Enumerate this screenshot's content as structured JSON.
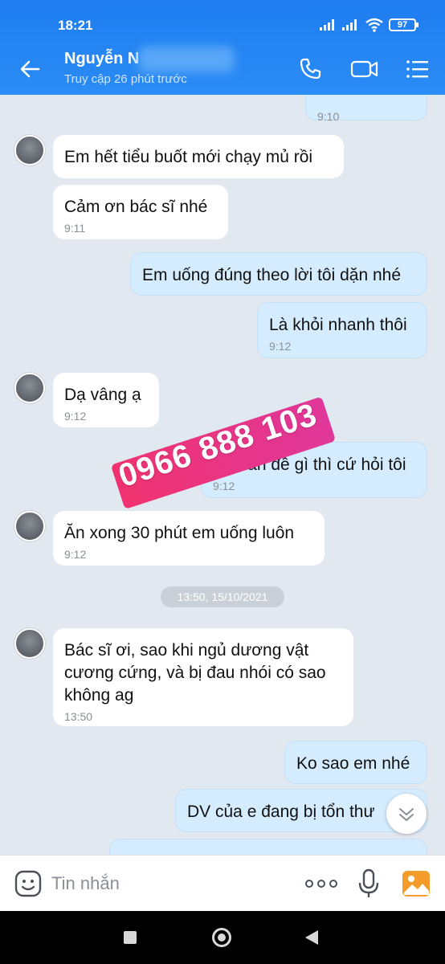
{
  "status_bar": {
    "time": "18:21",
    "battery": "97"
  },
  "header": {
    "contact_name": "Nguyễn N",
    "last_seen": "Truy cập 26 phút trước",
    "icons": [
      "back-arrow-icon",
      "phone-icon",
      "video-call-icon",
      "menu-list-icon"
    ]
  },
  "messages": [
    {
      "side": "out",
      "text": "",
      "time": "9:10"
    },
    {
      "side": "in",
      "text": "Em hết tiểu buốt mới chạy mủ rồi",
      "time": ""
    },
    {
      "side": "in",
      "text": "Cảm ơn bác sĩ nhé",
      "time": "9:11"
    },
    {
      "side": "out",
      "text": "Em uống đúng theo lời tôi dặn nhé",
      "time": ""
    },
    {
      "side": "out",
      "text": "Là khỏi nhanh thôi",
      "time": "9:12"
    },
    {
      "side": "in",
      "text": "Dạ vâng ạ",
      "time": "9:12"
    },
    {
      "side": "out",
      "text": "Có vấn đề gì thì cứ hỏi tôi",
      "time": "9:12"
    },
    {
      "side": "in",
      "text": "Ăn xong 30 phút em uống luôn",
      "time": "9:12"
    },
    {
      "side": "in",
      "lines": [
        "Bác sĩ ơi, sao khi ngủ dương vật",
        "cương cứng, và bị đau nhói có sao",
        "không ag"
      ],
      "time": "13:50"
    },
    {
      "side": "out",
      "text": "Ko sao em nhé",
      "time": ""
    },
    {
      "side": "out",
      "text": "DV của e đang bị tổn thư",
      "time": ""
    }
  ],
  "date_separator": "13:50, 15/10/2021",
  "watermark": "0966 888 103",
  "input": {
    "placeholder": "Tin nhắn"
  },
  "colors": {
    "header": "#1f7df0",
    "bubble_out": "#d5ecff",
    "bubble_in": "#ffffff",
    "background": "#e2e8ef",
    "watermark": "#f0336f"
  }
}
